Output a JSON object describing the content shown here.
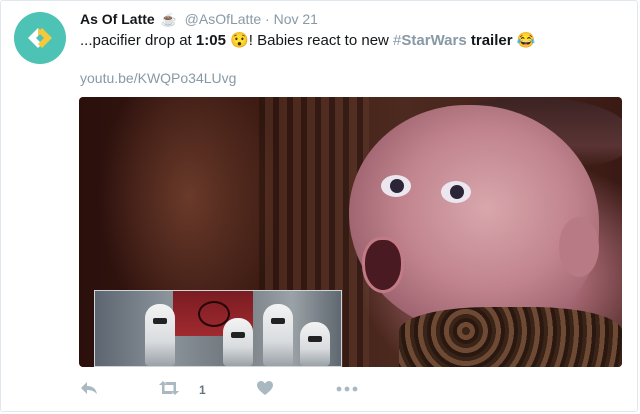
{
  "tweet": {
    "name": "As Of Latte",
    "cup_glyph": "☕",
    "handle": "@AsOfLatte",
    "separator": "·",
    "date": "Nov 21",
    "text_part1": "...pacifier drop at ",
    "time_bold": "1:05",
    "emoji_surprised": "😯",
    "text_part2": "! Babies react to new ",
    "hashtag_hash": "#",
    "hashtag_word": "StarWars",
    "text_part3": " ",
    "trailer_bold": "trailer",
    "emoji_laughing": "😂",
    "link": "youtu.be/KWQPo34LUvg"
  },
  "actions": {
    "retweet_count": "1"
  },
  "icons": {
    "avatar": "aol-logo-icon",
    "reply": "reply-icon",
    "retweet": "retweet-icon",
    "like": "heart-icon",
    "more": "more-dots-icon"
  },
  "colors": {
    "avatar_bg": "#4cc3b5",
    "muted": "#8899a6",
    "action_icon": "#aab8c2"
  }
}
